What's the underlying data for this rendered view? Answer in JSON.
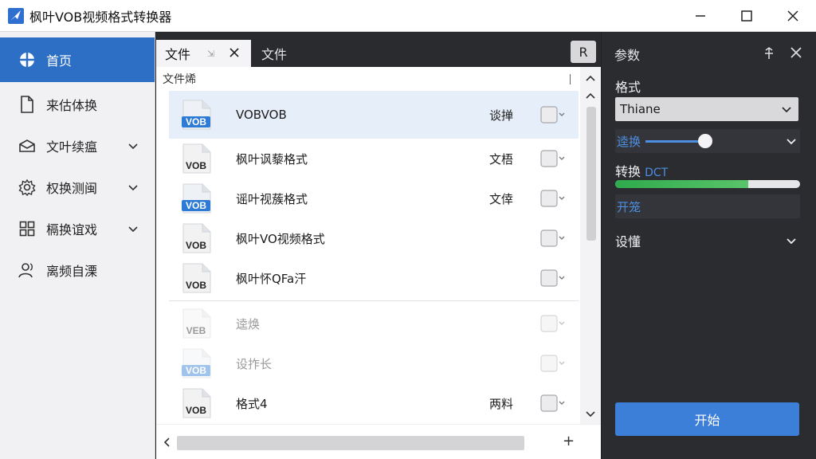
{
  "window": {
    "title": "枫叶VOB视频格式转换器",
    "icon": "app-logo-icon",
    "controls": [
      "minimize-icon",
      "maximize-icon",
      "close-icon"
    ]
  },
  "sidebar": {
    "items": [
      {
        "label": "首页",
        "icon": "home-icon",
        "active": true,
        "has_chevron": false
      },
      {
        "label": "来估体换",
        "icon": "document-icon",
        "active": false,
        "has_chevron": false
      },
      {
        "label": "文叶续瘟",
        "icon": "mail-icon",
        "active": false,
        "has_chevron": true
      },
      {
        "label": "权换测闽",
        "icon": "gear-icon",
        "active": false,
        "has_chevron": true
      },
      {
        "label": "槅换谊戏",
        "icon": "grid-icon",
        "active": false,
        "has_chevron": true
      },
      {
        "label": "离频自溧",
        "icon": "user-icon",
        "active": false,
        "has_chevron": false
      }
    ]
  },
  "tabs": {
    "active_label": "文件",
    "active_pin": "⇲",
    "second_label": "文件",
    "r_button": "R"
  },
  "file_panel": {
    "header": "文件烯",
    "files": [
      {
        "name": "VOBVOB",
        "status": "谈掸",
        "thumb": "VOB",
        "style": "blue",
        "selected": true,
        "faded": false
      },
      {
        "name": "枫叶讽藜格式",
        "status": "文梧",
        "thumb": "VOB",
        "style": "gray",
        "selected": false,
        "faded": false
      },
      {
        "name": "谣叶视蔟格式",
        "status": "文倖",
        "thumb": "VOB",
        "style": "blue",
        "selected": false,
        "faded": false
      },
      {
        "name": "枫叶VO视频格式",
        "status": "",
        "thumb": "VOB",
        "style": "gray",
        "selected": false,
        "faded": false
      },
      {
        "name": "枫叶怀QFa汗",
        "status": "",
        "thumb": "VOB",
        "style": "gray",
        "selected": false,
        "faded": false
      },
      {
        "name": "逵焕",
        "status": "",
        "thumb": "VEB",
        "style": "gray",
        "selected": false,
        "faded": true
      },
      {
        "name": "设拃长",
        "status": "",
        "thumb": "VOB",
        "style": "blue",
        "selected": false,
        "faded": true
      },
      {
        "name": "格式4",
        "status": "两料",
        "thumb": "VOB",
        "style": "gray",
        "selected": false,
        "faded": false
      }
    ]
  },
  "params": {
    "title": "参数",
    "format_label": "格式",
    "format_value": "Thiane",
    "slider_label": "逵换",
    "slider_level": 0.55,
    "progress_label": "转换",
    "progress_suffix": "DCT",
    "progress_value": 0.72,
    "open_label": "开笼",
    "settings_label": "设懂",
    "start_button": "开始"
  },
  "colors": {
    "accent": "#2d6fc4",
    "progress": "#2eaa4c",
    "start": "#3b7fd9"
  }
}
